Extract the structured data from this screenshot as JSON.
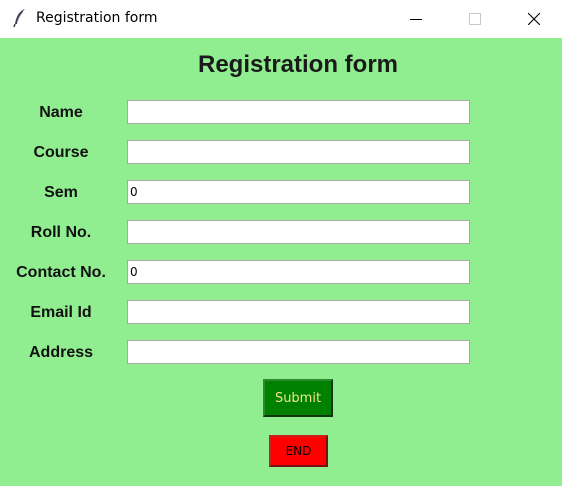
{
  "window": {
    "title": "Registration form",
    "icon": "feather-icon",
    "controls": [
      "minimize-icon",
      "maximize-icon",
      "close-icon"
    ]
  },
  "form": {
    "heading": "Registration form",
    "fields": [
      {
        "label": "Name",
        "value": ""
      },
      {
        "label": "Course",
        "value": ""
      },
      {
        "label": "Sem",
        "value": "0"
      },
      {
        "label": "Roll No.",
        "value": ""
      },
      {
        "label": "Contact No.",
        "value": "0"
      },
      {
        "label": "Email Id",
        "value": ""
      },
      {
        "label": "Address",
        "value": ""
      }
    ],
    "submit_label": "Submit",
    "end_label": "END"
  },
  "colors": {
    "background": "#90ee90",
    "submit_bg": "#008000",
    "submit_fg": "#f0e68c",
    "end_bg": "#ff0000"
  }
}
